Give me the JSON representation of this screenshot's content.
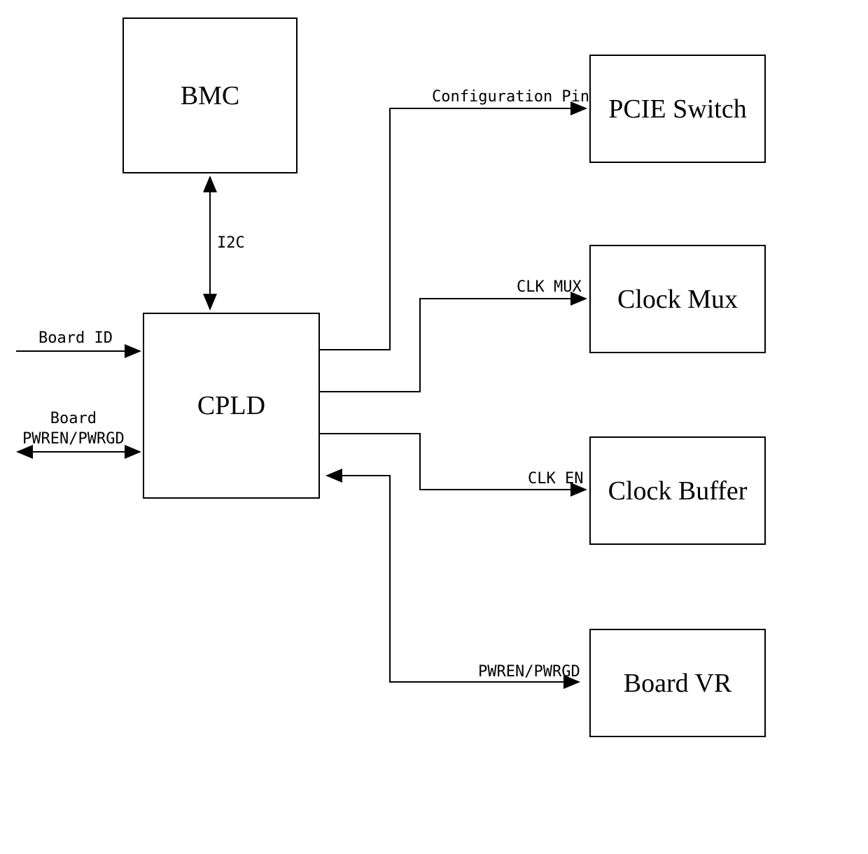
{
  "blocks": {
    "bmc": "BMC",
    "cpld": "CPLD",
    "pcie_switch": "PCIE Switch",
    "clock_mux": "Clock Mux",
    "clock_buffer": "Clock Buffer",
    "board_vr": "Board VR"
  },
  "signals": {
    "i2c": "I2C",
    "configuration_pin": "Configuration Pin",
    "clk_mux": "CLK MUX",
    "clk_en": "CLK EN",
    "pwren_pwrgd": "PWREN/PWRGD"
  },
  "inputs": {
    "board_id": "Board ID",
    "board_pwren_pwrgd": "Board\nPWREN/PWRGD"
  }
}
